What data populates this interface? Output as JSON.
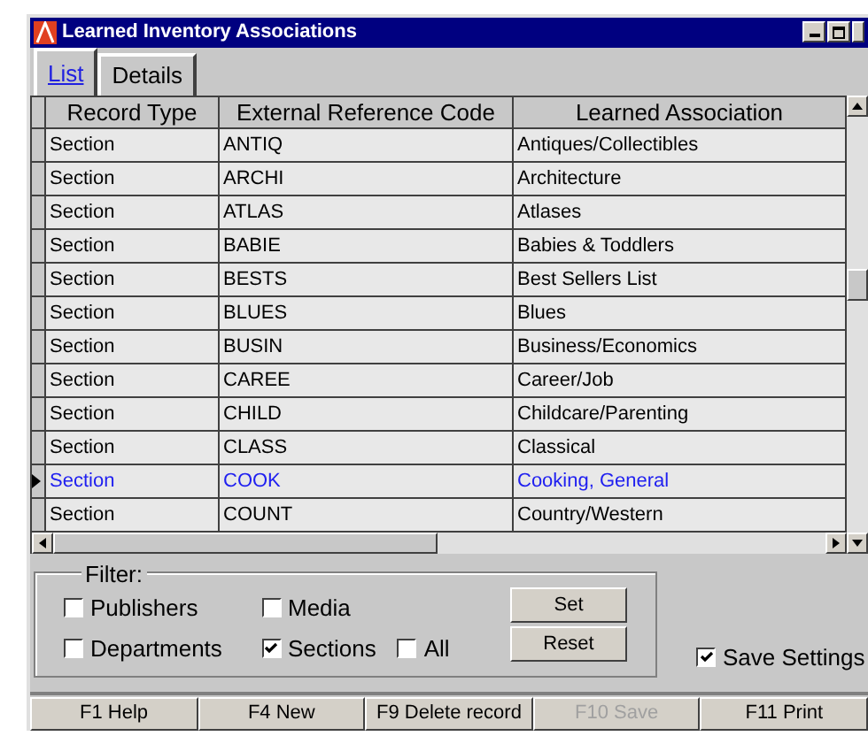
{
  "window": {
    "title": "Learned Inventory Associations"
  },
  "tabs": [
    {
      "label": "List",
      "selected": true
    },
    {
      "label": "Details",
      "selected": false
    }
  ],
  "table": {
    "columns": [
      "Record Type",
      "External Reference Code",
      "Learned Association"
    ],
    "rows": [
      {
        "cells": [
          "Section",
          "ANTIQ",
          "Antiques/Collectibles"
        ],
        "selected": false
      },
      {
        "cells": [
          "Section",
          "ARCHI",
          "Architecture"
        ],
        "selected": false
      },
      {
        "cells": [
          "Section",
          "ATLAS",
          "Atlases"
        ],
        "selected": false
      },
      {
        "cells": [
          "Section",
          "BABIE",
          "Babies & Toddlers"
        ],
        "selected": false
      },
      {
        "cells": [
          "Section",
          "BESTS",
          "Best Sellers List"
        ],
        "selected": false
      },
      {
        "cells": [
          "Section",
          "BLUES",
          "Blues"
        ],
        "selected": false
      },
      {
        "cells": [
          "Section",
          "BUSIN",
          "Business/Economics"
        ],
        "selected": false
      },
      {
        "cells": [
          "Section",
          "CAREE",
          "Career/Job"
        ],
        "selected": false
      },
      {
        "cells": [
          "Section",
          "CHILD",
          "Childcare/Parenting"
        ],
        "selected": false
      },
      {
        "cells": [
          "Section",
          "CLASS",
          "Classical"
        ],
        "selected": false
      },
      {
        "cells": [
          "Section",
          "COOK",
          "Cooking, General"
        ],
        "selected": true
      },
      {
        "cells": [
          "Section",
          "COUNT",
          "Country/Western"
        ],
        "selected": false
      }
    ]
  },
  "filter": {
    "label": "Filter:",
    "options": [
      {
        "label": "Publishers",
        "checked": false
      },
      {
        "label": "Media",
        "checked": false
      },
      {
        "label": "Departments",
        "checked": false
      },
      {
        "label": "Sections",
        "checked": true
      },
      {
        "label": "All",
        "checked": false
      }
    ],
    "buttons": [
      "Set",
      "Reset"
    ]
  },
  "save_settings": {
    "label": "Save Settings",
    "checked": true
  },
  "function_keys": [
    {
      "label": "F1 Help",
      "disabled": false
    },
    {
      "label": "F4 New",
      "disabled": false
    },
    {
      "label": "F9 Delete record",
      "disabled": false
    },
    {
      "label": "F10 Save",
      "disabled": true
    },
    {
      "label": "F11 Print",
      "disabled": false
    }
  ]
}
